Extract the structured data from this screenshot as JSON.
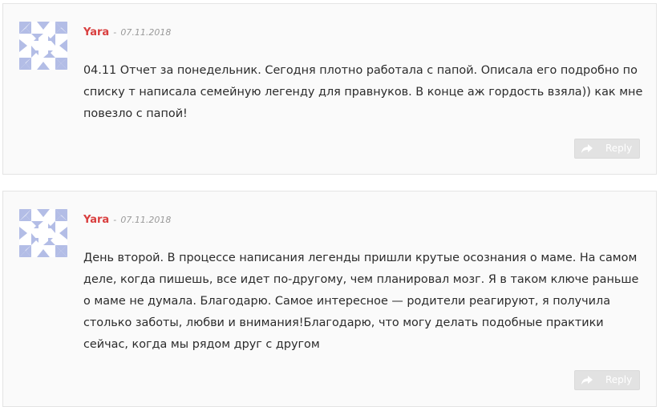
{
  "comments": [
    {
      "author": "Yara",
      "separator": "-",
      "date": "07.11.2018",
      "text": "04.11 Отчет за понедельник. Сегодня плотно работала с папой. Описала его подробно по списку т написала семейную легенду для правнуков. В конце аж гордость взяла)) как мне повезло с папой!",
      "reply_label": "Reply"
    },
    {
      "author": "Yara",
      "separator": "-",
      "date": "07.11.2018",
      "text": "День второй. В процессе написания легенды пришли крутые осознания о маме. На самом деле, когда пишешь, все идет по-другому, чем планировал мозг. Я в таком ключе раньше о маме не думала. Благодарю. Самое интересное — родители реагируют, я получила столько заботы, любви и внимания!Благодарю, что могу делать подобные практики сейчас, когда мы рядом друг с другом",
      "reply_label": "Reply"
    }
  ],
  "colors": {
    "author": "#d93f3f",
    "avatar_pattern": "#b3bde6",
    "reply_bg": "#e2e2e2"
  },
  "icons": {
    "avatar": "identicon-avatar",
    "reply": "reply-arrow-icon"
  }
}
